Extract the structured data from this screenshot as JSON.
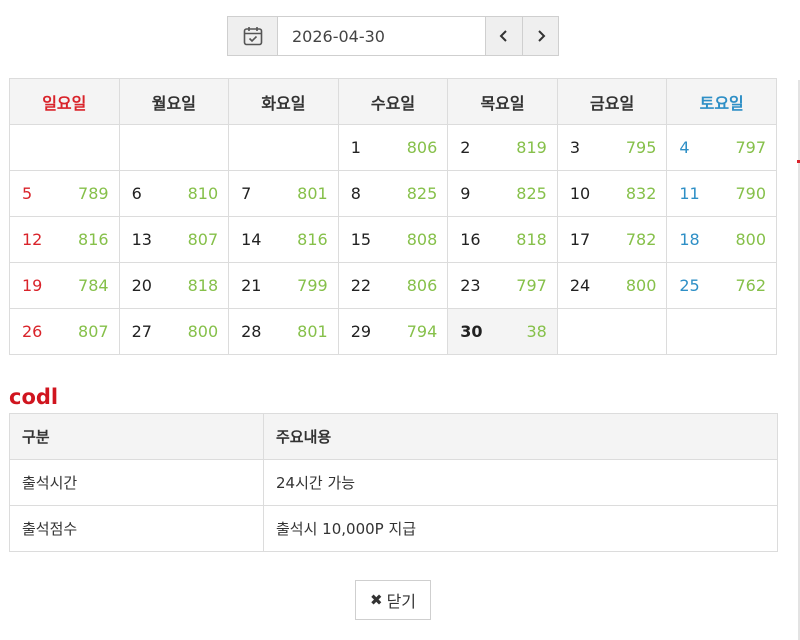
{
  "date_picker": {
    "value": "2026-04-30",
    "prev_icon": "chevron-left-icon",
    "next_icon": "chevron-right-icon",
    "calendar_icon": "calendar-check-icon"
  },
  "calendar": {
    "weekdays": [
      "일요일",
      "월요일",
      "화요일",
      "수요일",
      "목요일",
      "금요일",
      "토요일"
    ],
    "colors": {
      "sunday": "#d9232a",
      "saturday": "#2e8fc6",
      "count": "#86c04a"
    },
    "weeks": [
      [
        {
          "day": "",
          "count": ""
        },
        {
          "day": "",
          "count": ""
        },
        {
          "day": "",
          "count": ""
        },
        {
          "day": "1",
          "count": "806"
        },
        {
          "day": "2",
          "count": "819"
        },
        {
          "day": "3",
          "count": "795"
        },
        {
          "day": "4",
          "count": "797"
        }
      ],
      [
        {
          "day": "5",
          "count": "789"
        },
        {
          "day": "6",
          "count": "810"
        },
        {
          "day": "7",
          "count": "801"
        },
        {
          "day": "8",
          "count": "825"
        },
        {
          "day": "9",
          "count": "825"
        },
        {
          "day": "10",
          "count": "832"
        },
        {
          "day": "11",
          "count": "790"
        }
      ],
      [
        {
          "day": "12",
          "count": "816"
        },
        {
          "day": "13",
          "count": "807"
        },
        {
          "day": "14",
          "count": "816"
        },
        {
          "day": "15",
          "count": "808"
        },
        {
          "day": "16",
          "count": "818"
        },
        {
          "day": "17",
          "count": "782"
        },
        {
          "day": "18",
          "count": "800"
        }
      ],
      [
        {
          "day": "19",
          "count": "784"
        },
        {
          "day": "20",
          "count": "818"
        },
        {
          "day": "21",
          "count": "799"
        },
        {
          "day": "22",
          "count": "806"
        },
        {
          "day": "23",
          "count": "797"
        },
        {
          "day": "24",
          "count": "800"
        },
        {
          "day": "25",
          "count": "762"
        }
      ],
      [
        {
          "day": "26",
          "count": "807"
        },
        {
          "day": "27",
          "count": "800"
        },
        {
          "day": "28",
          "count": "801"
        },
        {
          "day": "29",
          "count": "794"
        },
        {
          "day": "30",
          "count": "38",
          "today": true
        },
        {
          "day": "",
          "count": ""
        },
        {
          "day": "",
          "count": ""
        }
      ]
    ]
  },
  "section": {
    "title": "codl",
    "title_color": "#d0151f"
  },
  "info_table": {
    "headers": [
      "구분",
      "주요내용"
    ],
    "rows": [
      [
        "출석시간",
        "24시간 가능"
      ],
      [
        "출석점수",
        "출석시 10,000P 지급"
      ]
    ]
  },
  "close_button": {
    "label": "닫기",
    "icon": "close-icon"
  }
}
